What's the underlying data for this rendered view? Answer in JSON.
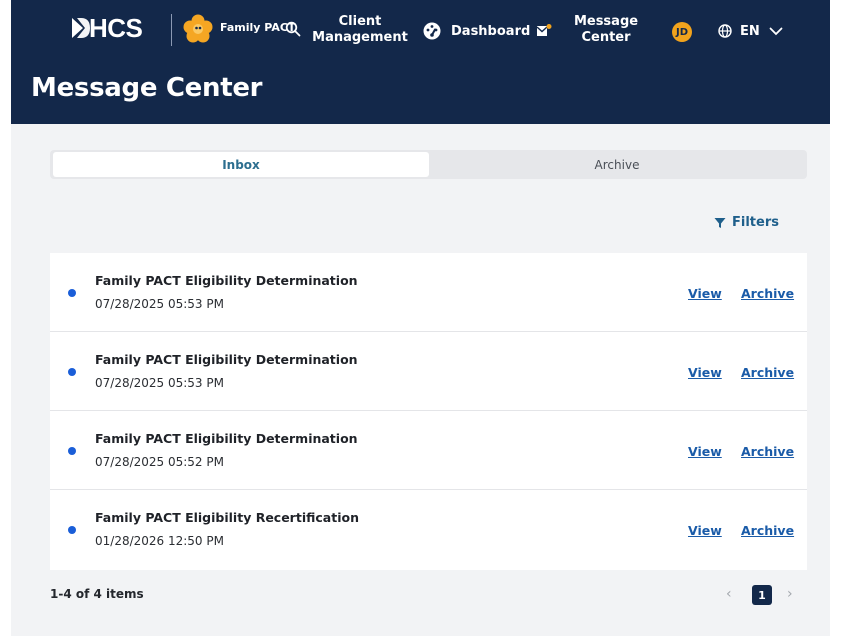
{
  "header": {
    "logo_text": "HCS",
    "program_label": "Family PACT",
    "nav": {
      "client_management_line1": "Client",
      "client_management_line2": "Management",
      "dashboard": "Dashboard",
      "message_center_line1": "Message",
      "message_center_line2": "Center"
    },
    "user_initials": "JD",
    "language": "EN"
  },
  "page": {
    "title": "Message Center"
  },
  "tabs": {
    "inbox": "Inbox",
    "archive": "Archive",
    "active": "inbox"
  },
  "filters_label": "Filters",
  "messages": [
    {
      "title": "Family PACT Eligibility Determination",
      "date": "07/28/2025 05:53 PM",
      "view": "View",
      "archive": "Archive",
      "unread": true
    },
    {
      "title": "Family PACT Eligibility Determination",
      "date": "07/28/2025 05:53 PM",
      "view": "View",
      "archive": "Archive",
      "unread": true
    },
    {
      "title": "Family PACT Eligibility Determination",
      "date": "07/28/2025 05:52 PM",
      "view": "View",
      "archive": "Archive",
      "unread": true
    },
    {
      "title": "Family PACT Eligibility Recertification",
      "date": "01/28/2026 12:50 PM",
      "view": "View",
      "archive": "Archive",
      "unread": true
    }
  ],
  "pagination": {
    "summary": "1-4 of 4 items",
    "prev": "‹",
    "current": "1",
    "next": "›"
  },
  "colors": {
    "navy": "#13284a",
    "unread_dot": "#1a5ed8",
    "link": "#1a5ba8",
    "accent_orange": "#f1a31d"
  }
}
